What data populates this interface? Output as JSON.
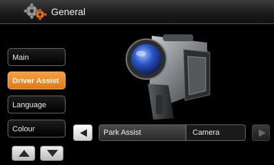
{
  "header": {
    "title": "General",
    "icon": "gears-icon"
  },
  "menu": {
    "items": [
      {
        "label": "Main",
        "active": false
      },
      {
        "label": "Driver Assist",
        "active": true
      },
      {
        "label": "Language",
        "active": false
      },
      {
        "label": "Colour",
        "active": false
      }
    ]
  },
  "scroll": {
    "up_icon": "triangle-up-icon",
    "down_icon": "triangle-down-icon"
  },
  "setting": {
    "label": "Park Assist",
    "value": "Camera",
    "prev_icon": "triangle-left-icon",
    "next_icon": "triangle-right-icon"
  },
  "colors": {
    "accent": "#e8832a",
    "background": "#000000"
  }
}
